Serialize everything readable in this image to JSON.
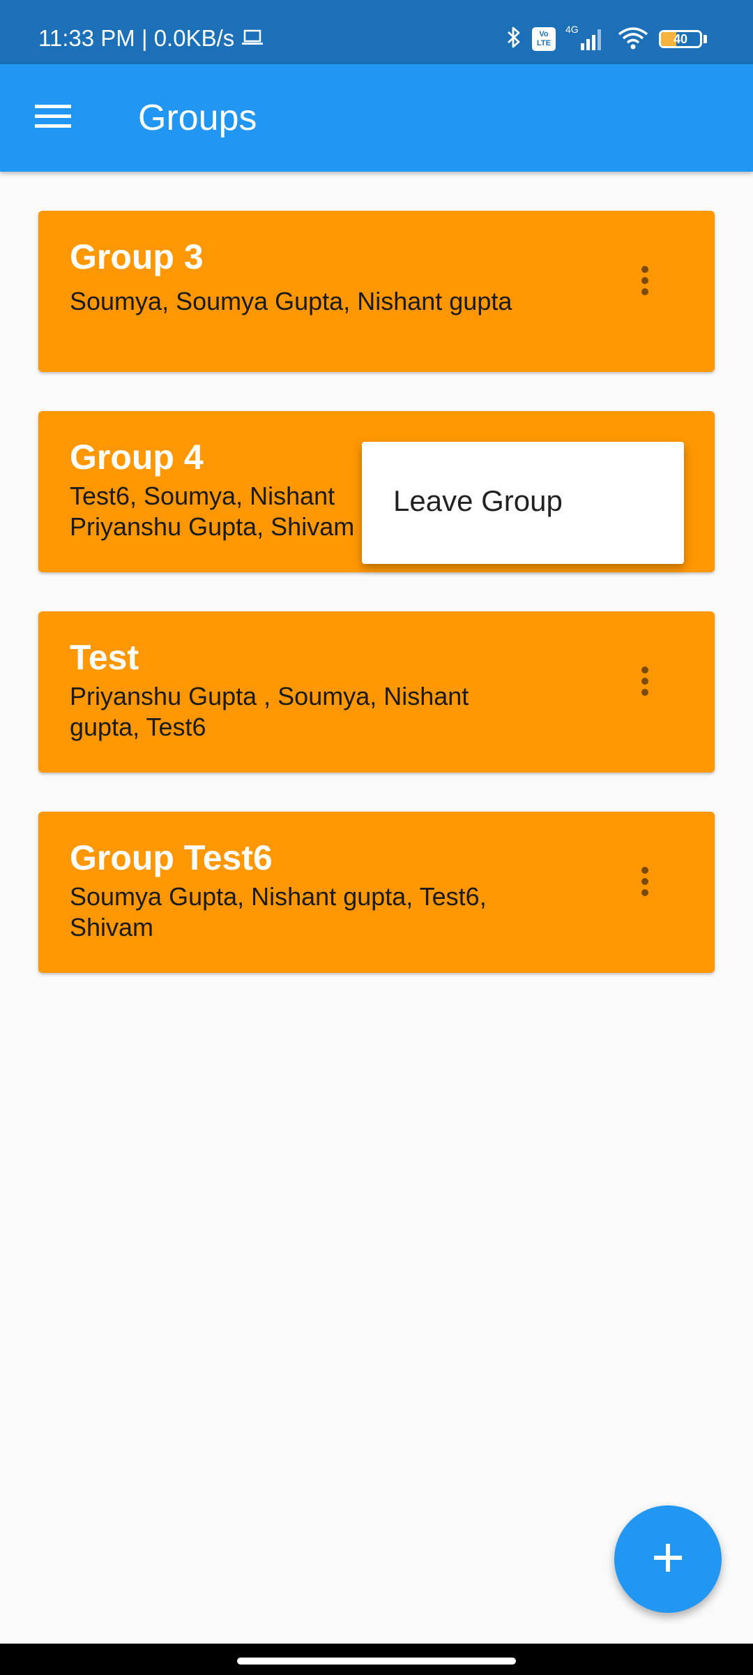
{
  "status_bar": {
    "time": "11:33 PM | 0.0KB/s",
    "icons": [
      "laptop-icon",
      "bluetooth-icon",
      "volte-icon",
      "signal-icon",
      "wifi-icon",
      "battery-icon"
    ],
    "volte_top": "Vo",
    "volte_bottom": "LTE",
    "network": "4G",
    "battery_level": "40",
    "battery_fraction": 0.4
  },
  "app_bar": {
    "title": "Groups",
    "menu_icon": "hamburger-icon",
    "color": "#2196f3"
  },
  "groups": [
    {
      "name": "Group 3",
      "members": "Soumya,  Soumya Gupta,  Nishant gupta"
    },
    {
      "name": "Group 4",
      "members": "Test6,  Soumya,  Nishant\nPriyanshu Gupta,  Shivam"
    },
    {
      "name": "Test",
      "members": "Priyanshu Gupta ,  Soumya,  Nishant\ngupta,  Test6"
    },
    {
      "name": "Group Test6",
      "members": "Soumya Gupta,  Nishant gupta,  Test6,\nShivam"
    }
  ],
  "card_color": "#ff9800",
  "popup_menu": {
    "items": [
      "Leave Group"
    ]
  },
  "fab": {
    "icon": "plus-icon",
    "color": "#2196f3"
  }
}
